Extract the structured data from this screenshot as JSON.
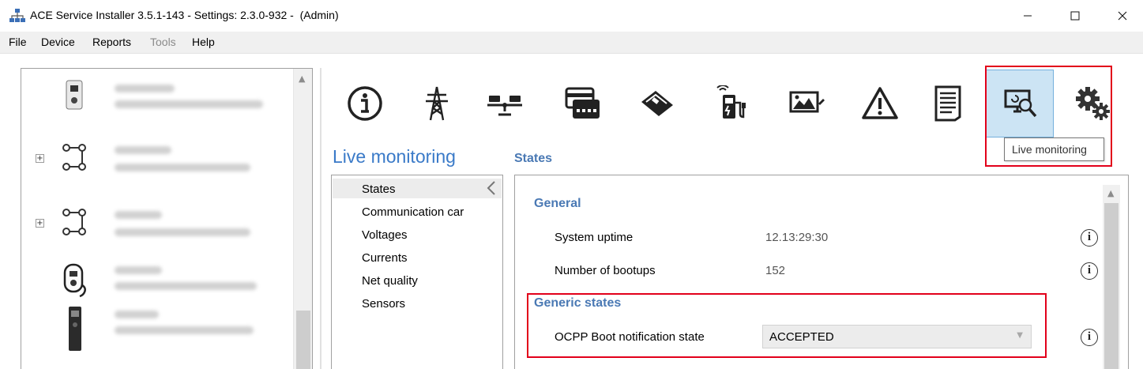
{
  "window": {
    "title": "ACE Service Installer 3.5.1-143 - Settings: 2.3.0-932 -  (Admin)",
    "controls": [
      "minimize",
      "maximize",
      "close"
    ]
  },
  "menu": {
    "items": [
      {
        "label": "File",
        "enabled": true
      },
      {
        "label": "Device",
        "enabled": true
      },
      {
        "label": "Reports",
        "enabled": true
      },
      {
        "label": "Tools",
        "enabled": false
      },
      {
        "label": "Help",
        "enabled": true
      }
    ]
  },
  "device_tree": {
    "note": "device names and serials are blurred in the screenshot",
    "rows": [
      {
        "icon": "wallbox-icon",
        "expandable": false
      },
      {
        "icon": "network-node-icon",
        "expandable": true
      },
      {
        "icon": "network-node-icon",
        "expandable": true
      },
      {
        "icon": "charger-cable-icon",
        "expandable": false
      },
      {
        "icon": "charging-column-icon",
        "expandable": false
      }
    ]
  },
  "toolbar": {
    "buttons": [
      {
        "icon": "info-icon",
        "active": false
      },
      {
        "icon": "power-pylon-icon",
        "active": false
      },
      {
        "icon": "balance-scale-icon",
        "active": false
      },
      {
        "icon": "card-reader-icon",
        "active": false
      },
      {
        "icon": "payment-terminal-icon",
        "active": false
      },
      {
        "icon": "wireless-charger-icon",
        "active": false
      },
      {
        "icon": "display-image-icon",
        "active": false
      },
      {
        "icon": "warning-icon",
        "active": false
      },
      {
        "icon": "document-icon",
        "active": false
      },
      {
        "icon": "live-monitoring-icon",
        "active": true
      },
      {
        "icon": "gears-icon",
        "active": false
      }
    ],
    "tooltip": "Live monitoring"
  },
  "section": {
    "title": "Live monitoring",
    "subtitle": "States"
  },
  "nav": {
    "items": [
      "States",
      "Communication car",
      "Voltages",
      "Currents",
      "Net quality",
      "Sensors"
    ],
    "selected": "States"
  },
  "content": {
    "general_title": "General",
    "system_uptime_label": "System uptime",
    "system_uptime_value": "12.13:29:30",
    "bootups_label": "Number of bootups",
    "bootups_value": "152",
    "generic_title": "Generic states",
    "ocpp_label": "OCPP Boot notification state",
    "ocpp_value": "ACCEPTED"
  },
  "colors": {
    "accent": "#3a7ac8",
    "group_title": "#4a79b4",
    "highlight": "#e2001a",
    "active_button": "#cce4f4"
  }
}
